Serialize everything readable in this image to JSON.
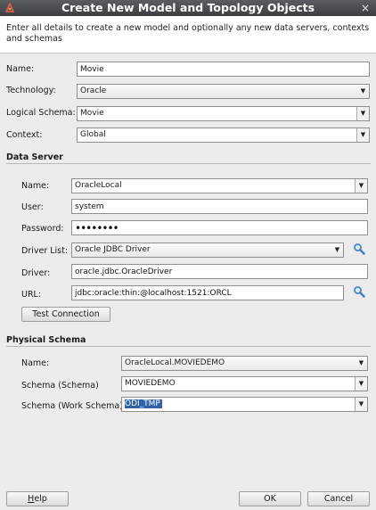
{
  "window": {
    "title": "Create New Model and Topology Objects",
    "close_glyph": "×",
    "intro": "Enter all details to create a new model and optionally any new data servers, contexts and schemas"
  },
  "model": {
    "name_label": "Name:",
    "name_value": "Movie",
    "technology_label": "Technology:",
    "technology_value": "Oracle",
    "logical_schema_label": "Logical Schema:",
    "logical_schema_value": "Movie",
    "context_label": "Context:",
    "context_value": "Global"
  },
  "data_server": {
    "section_title": "Data Server",
    "name_label": "Name:",
    "name_value": "OracleLocal",
    "user_label": "User:",
    "user_value": "system",
    "password_label": "Password:",
    "password_value": "••••••••",
    "driver_list_label": "Driver List:",
    "driver_list_value": "Oracle JDBC Driver",
    "driver_label": "Driver:",
    "driver_value": "oracle.jdbc.OracleDriver",
    "url_label": "URL:",
    "url_value": "jdbc:oracle:thin:@localhost:1521:ORCL",
    "test_connection_label": "Test Connection"
  },
  "physical_schema": {
    "section_title": "Physical Schema",
    "name_label": "Name:",
    "name_value": "OracleLocal.MOVIEDEMO",
    "schema_label": "Schema (Schema)",
    "schema_value": "MOVIEDEMO",
    "work_schema_label": "Schema (Work Schema)",
    "work_schema_value": "ODI_TMP"
  },
  "footer": {
    "help_prefix": "",
    "help_mnemonic": "H",
    "help_rest": "elp",
    "ok_label": "OK",
    "cancel_label": "Cancel"
  },
  "icons": {
    "combo_arrow": "▼",
    "app": "odi-app-icon",
    "search": "search-icon"
  },
  "colors": {
    "titlebar": "#3b3d41",
    "selection": "#2f62a6",
    "search_icon": "#3d7fc4"
  }
}
